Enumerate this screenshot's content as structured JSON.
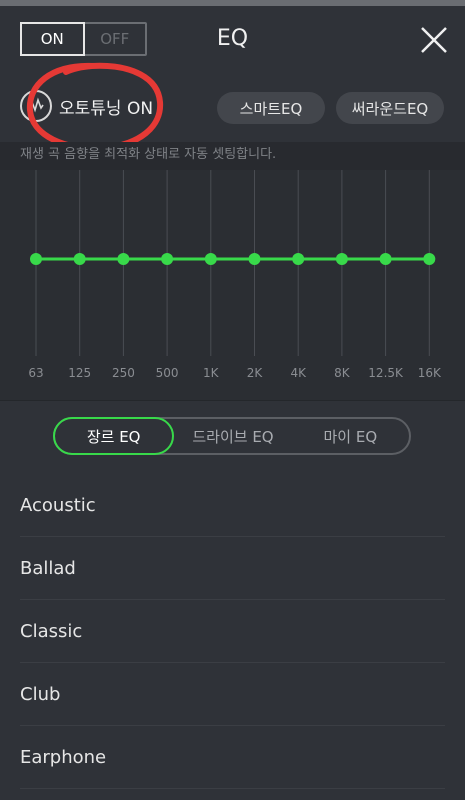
{
  "header": {
    "toggle_on": "ON",
    "toggle_off": "OFF",
    "title": "EQ",
    "close_icon": "close-icon"
  },
  "auto_tuning": {
    "icon": "auto-tune-icon",
    "label": "오토튜닝 ON",
    "highlight_color": "#e53935"
  },
  "modes": {
    "smart": "스마트EQ",
    "surround": "써라운드EQ"
  },
  "hint": "재생 곡 음향을 최적화 상태로 자동 셋팅합니다.",
  "eq": {
    "accent": "#38d94a",
    "bands": [
      "63",
      "125",
      "250",
      "500",
      "1K",
      "2K",
      "4K",
      "8K",
      "12.5K",
      "16K"
    ],
    "levels": [
      0,
      0,
      0,
      0,
      0,
      0,
      0,
      0,
      0,
      0
    ]
  },
  "tabs": [
    {
      "label": "장르 EQ",
      "active": true
    },
    {
      "label": "드라이브 EQ",
      "active": false
    },
    {
      "label": "마이 EQ",
      "active": false
    }
  ],
  "presets": [
    "Acoustic",
    "Ballad",
    "Classic",
    "Club",
    "Earphone"
  ]
}
